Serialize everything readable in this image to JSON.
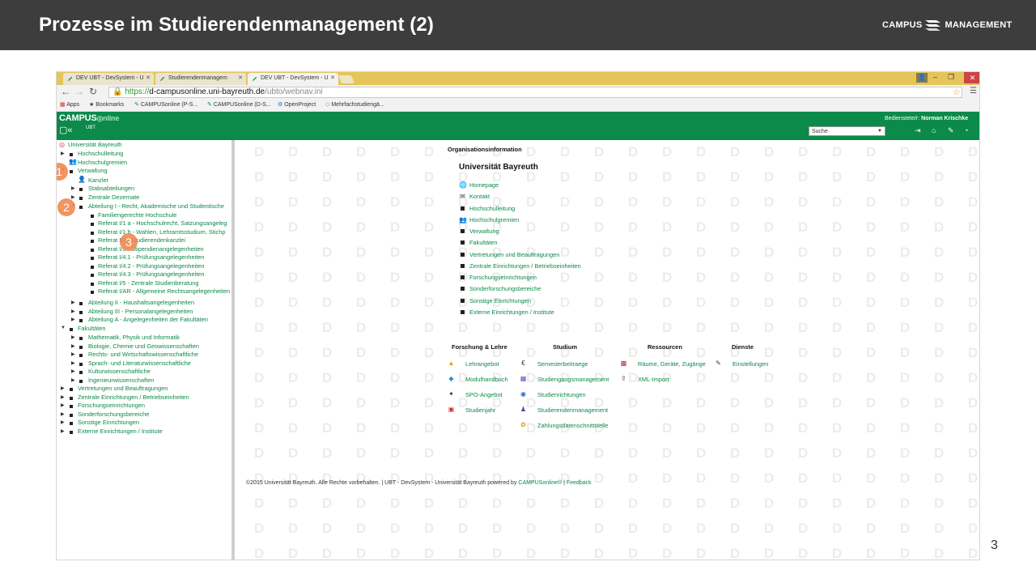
{
  "slide": {
    "title": "Prozesse im Studierendenmanagement (2)",
    "brand_left": "CAMPUS",
    "brand_right": "MANAGEMENT",
    "page_number": "3"
  },
  "browser": {
    "tabs": [
      {
        "label": "DEV UBT - DevSystem - U"
      },
      {
        "label": "Studierendenmanagem"
      },
      {
        "label": "DEV UBT - DevSystem - U"
      }
    ],
    "url_scheme": "https://",
    "url_host": "d-campusonline.uni-bayreuth.de",
    "url_path": "/ubto/webnav.ini",
    "bookmarks": [
      "Apps",
      "Bookmarks",
      "CAMPUSonline (P-S...",
      "CAMPUSonline (D-S...",
      "OpenProject",
      "Mehrfachstudiengä..."
    ]
  },
  "app": {
    "logo": "CAMPUS",
    "logo_suffix": "nline",
    "sub": "UBT",
    "user_label": "Bedienstete/r:",
    "user_name": "Norman Krischke",
    "search_value": "Suche"
  },
  "tree": {
    "root": "Universität Bayreuth",
    "items": [
      {
        "label": "Hochschulleitung"
      },
      {
        "label": "Hochschulgremien"
      },
      {
        "label": "Verwaltung"
      },
      {
        "label": "Kanzler"
      },
      {
        "label": "Stabsabteilungen"
      },
      {
        "label": "Zentrale Dezernate"
      },
      {
        "label": "Abteilung I - Recht, Akademische und Studentische"
      },
      {
        "label": "Familiengerechte Hochschule"
      },
      {
        "label": "Referat I/1 a - Hochschulrecht, Satzungsangeleg"
      },
      {
        "label": "Referat I/1 b - Wahlen, Lehramtsstudium, Stichp"
      },
      {
        "label": "Referat I/2 - Studierendenkanzlei"
      },
      {
        "label": "Referat I/3 - Stipendienangelegenheiten"
      },
      {
        "label": "Referat I/4.1 - Prüfungsangelegenheiten"
      },
      {
        "label": "Referat I/4.2 - Prüfungsangelegenheiten"
      },
      {
        "label": "Referat I/4.3 - Prüfungsangelegenheiten"
      },
      {
        "label": "Referat I/5 - Zentrale Studienberatung"
      },
      {
        "label": "Referat I/AR - Allgemeine Rechtsangelegenheiten"
      },
      {
        "label": "Abteilung II - Haushaltsangelegenheiten"
      },
      {
        "label": "Abteilung III - Personalangelegenheiten"
      },
      {
        "label": "Abteilung A - Angelegenheiten der Fakultäten"
      },
      {
        "label": "Fakultäten"
      },
      {
        "label": "Mathematik, Physik und Informatik"
      },
      {
        "label": "Biologie, Chemie und Geowissenschaften"
      },
      {
        "label": "Rechts- und Wirtschaftswissenschaftliche"
      },
      {
        "label": "Sprach- und Literaturwissenschaftliche"
      },
      {
        "label": "Kulturwissenschaftliche"
      },
      {
        "label": "Ingenieurwissenschaften"
      },
      {
        "label": "Vertretungen und Beauftragungen"
      },
      {
        "label": "Zentrale Einrichtungen / Betriebseinheiten"
      },
      {
        "label": "Forschungseinrichtungen"
      },
      {
        "label": "Sonderforschungsbereiche"
      },
      {
        "label": "Sonstige Einrichtungen"
      },
      {
        "label": "Externe Einrichtungen / Institute"
      }
    ],
    "badges": [
      "1",
      "2",
      "3"
    ]
  },
  "main": {
    "section_label": "Organisationsinformation",
    "org_name": "Universität Bayreuth",
    "links": [
      {
        "label": "Homepage",
        "icon": "globe-icon"
      },
      {
        "label": "Kontakt",
        "icon": "mail-icon"
      },
      {
        "label": "Hochschulleitung",
        "icon": "bullet"
      },
      {
        "label": "Hochschulgremien",
        "icon": "group-icon"
      },
      {
        "label": "Verwaltung",
        "icon": "bullet"
      },
      {
        "label": "Fakultäten",
        "icon": "bullet"
      },
      {
        "label": "Vertretungen und Beauftragungen",
        "icon": "bullet"
      },
      {
        "label": "Zentrale Einrichtungen / Betriebseinheiten",
        "icon": "bullet"
      },
      {
        "label": "Forschungseinrichtungen",
        "icon": "bullet"
      },
      {
        "label": "Sonderforschungsbereiche",
        "icon": "bullet"
      },
      {
        "label": "Sonstige Einrichtungen",
        "icon": "bullet"
      },
      {
        "label": "Externe Einrichtungen / Institute",
        "icon": "bullet"
      }
    ],
    "columns": [
      {
        "head": "Forschung & Lehre",
        "items": [
          "Lehrangebot",
          "Modulhandbuch",
          "SPO-Angebot",
          "Studienjahr"
        ]
      },
      {
        "head": "Studium",
        "items": [
          "Semesterbeitraege",
          "Studiengangsmanagement",
          "Studienrichtungen",
          "Studierendenmanagement",
          "Zahlungsdatenschnittstelle"
        ]
      },
      {
        "head": "Ressourcen",
        "items": [
          "Räume, Geräte, Zugänge",
          "XML-Import"
        ]
      },
      {
        "head": "Dienste",
        "items": [
          "Einstellungen"
        ]
      }
    ],
    "footer_text": "©2015 Universität Bayreuth. Alle Rechte vorbehalten. | UBT - DevSystem - Universität Bayreuth powered by",
    "footer_link1": "CAMPUSonline®",
    "footer_sep": "|",
    "footer_link2": "Feedback"
  }
}
